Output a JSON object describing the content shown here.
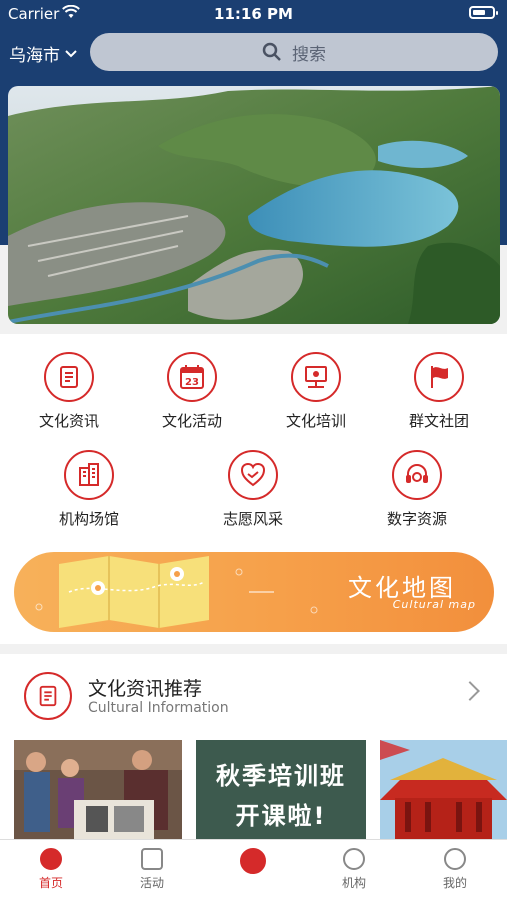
{
  "status": {
    "carrier": "Carrier",
    "time": "11:16 PM"
  },
  "header": {
    "city": "乌海市",
    "search_placeholder": "搜索"
  },
  "icons": [
    {
      "label": "文化资讯",
      "icon": "document-icon"
    },
    {
      "label": "文化活动",
      "icon": "calendar-icon"
    },
    {
      "label": "文化培训",
      "icon": "training-icon"
    },
    {
      "label": "群文社团",
      "icon": "flag-icon"
    },
    {
      "label": "机构场馆",
      "icon": "building-icon"
    },
    {
      "label": "志愿风采",
      "icon": "handshake-icon"
    },
    {
      "label": "数字资源",
      "icon": "headset-icon"
    }
  ],
  "calendar_day": "23",
  "map_banner": {
    "title": "文化地图",
    "subtitle": "Cultural map"
  },
  "section": {
    "title": "文化资讯推荐",
    "subtitle": "Cultural Information"
  },
  "cards": {
    "training_text_1": "秋季培训班",
    "training_text_2": "开课啦!"
  },
  "tabbar": [
    {
      "label": "首页",
      "active": true
    },
    {
      "label": "活动",
      "active": false
    },
    {
      "label": "",
      "active": false
    },
    {
      "label": "机构",
      "active": false
    },
    {
      "label": "我的",
      "active": false
    }
  ],
  "colors": {
    "accent": "#d52a2a",
    "header": "#1b3f72",
    "map_orange": "#f6a04a"
  }
}
